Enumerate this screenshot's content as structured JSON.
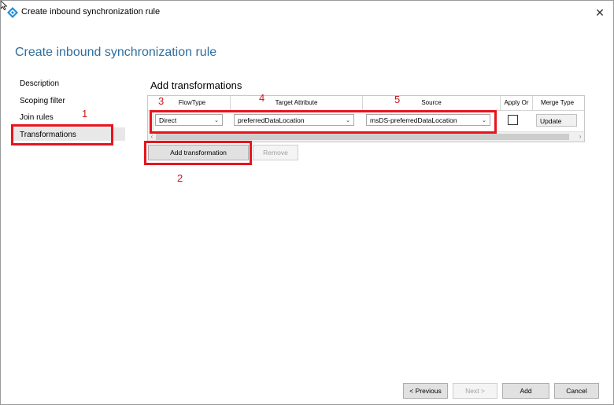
{
  "window": {
    "title": "Create inbound synchronization rule",
    "close_glyph": "✕"
  },
  "heading": "Create inbound synchronization rule",
  "nav": {
    "items": [
      {
        "label": "Description"
      },
      {
        "label": "Scoping filter"
      },
      {
        "label": "Join rules"
      },
      {
        "label": "Transformations",
        "selected": true
      }
    ]
  },
  "section_title": "Add transformations",
  "grid": {
    "columns": [
      "FlowType",
      "Target Attribute",
      "Source",
      "Apply Or",
      "Merge Type"
    ],
    "row": {
      "flow_type": "Direct",
      "target_attribute": "preferredDataLocation",
      "source": "msDS-preferredDataLocation",
      "apply_once": false,
      "merge_type": "Update"
    }
  },
  "buttons": {
    "add_transformation": "Add transformation",
    "remove": "Remove",
    "previous": "< Previous",
    "next": "Next >",
    "add": "Add",
    "cancel": "Cancel"
  },
  "annotations": [
    "1",
    "2",
    "3",
    "4",
    "5"
  ],
  "colors": {
    "heading": "#2e6e9e",
    "highlight": "#e8141c",
    "annotation_text": "#d0141c"
  },
  "icons": {
    "app": "sync-diamond-icon",
    "close": "close-icon",
    "dropdown": "chevron-down-icon"
  }
}
